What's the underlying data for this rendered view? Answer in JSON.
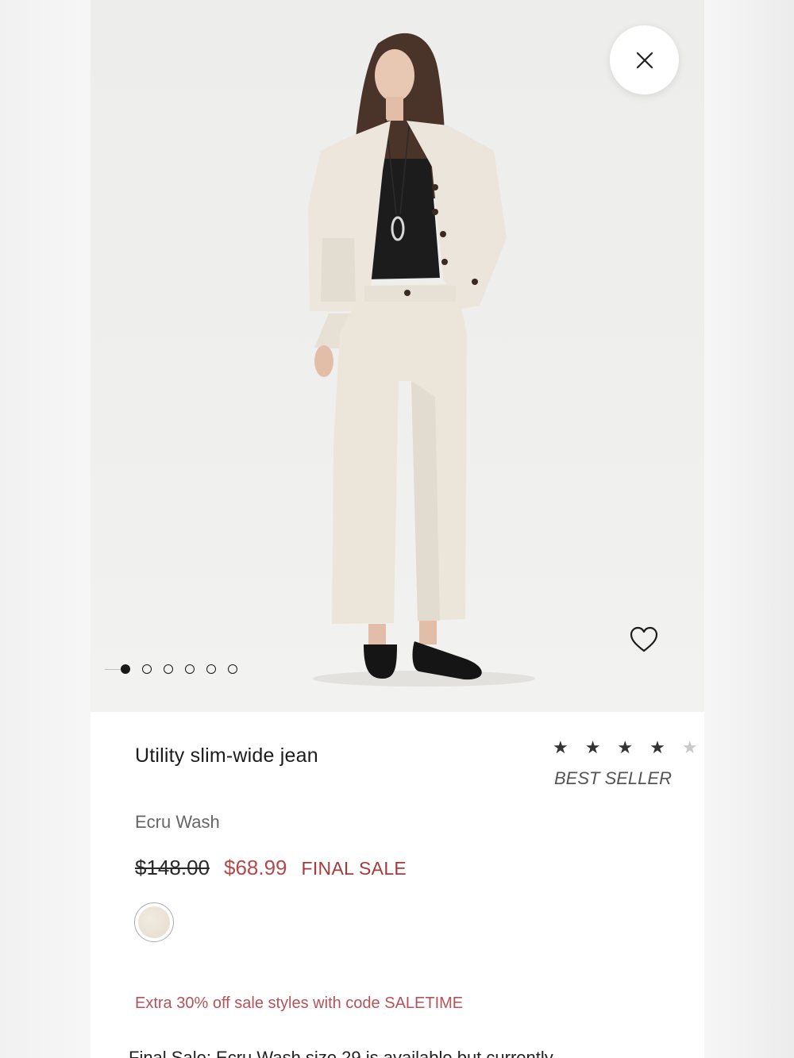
{
  "product": {
    "name": "Utility slim-wide jean",
    "rating_stars": "★ ★ ★ ★",
    "rating_half_star": "★",
    "rating_value": 4.5,
    "badge": "BEST SELLER",
    "color_name": "Ecru Wash",
    "original_price": "$148.00",
    "sale_price": "$68.99",
    "sale_tag": "FINAL SALE",
    "swatch_color": "#ebe4d8"
  },
  "gallery": {
    "total_images": 6,
    "active_index": 0
  },
  "icons": {
    "close": "close-icon",
    "wishlist": "heart-icon"
  },
  "promo": {
    "text": "Extra 30% off sale styles with code SALETIME"
  },
  "description_cut": {
    "text": "Final Sale: Ecru Wash size 29 is available but currently"
  },
  "colors": {
    "accent_red": "#b24a4a",
    "promo_text": "#b5525a"
  }
}
